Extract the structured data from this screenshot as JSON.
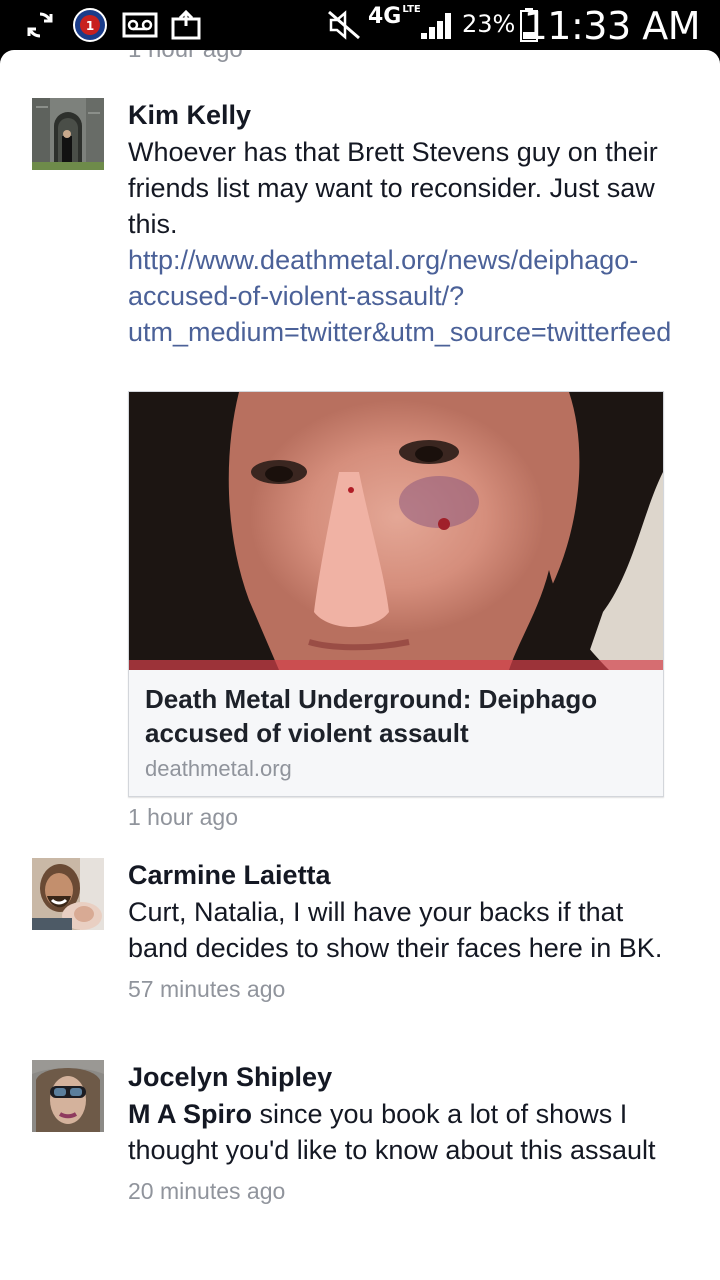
{
  "status_bar": {
    "icons_left": [
      "sync-icon",
      "app-badge-icon",
      "voicemail-icon",
      "upload-icon"
    ],
    "network": "4G",
    "network_sub": "LTE",
    "battery_percent": "23%",
    "time": "11:33 AM"
  },
  "top_partial_timestamp": "1 hour ago",
  "comments": [
    {
      "author": "Kim Kelly",
      "text": "Whoever has that Brett Stevens guy on their friends list may want to reconsider. Just saw this. ",
      "link": "http://www.deathmetal.org/news/deiphago-accused-of-violent-assault/?utm_medium=twitter&utm_source=twitterfeed",
      "link_preview": {
        "title": "Death Metal Underground: Deiphago accused of violent assault",
        "domain": "deathmetal.org"
      },
      "timestamp": "1 hour ago"
    },
    {
      "author": "Carmine Laietta",
      "text": "Curt, Natalia, I will have your backs if that band decides to show their faces here in BK.",
      "timestamp": "57 minutes ago"
    },
    {
      "author": "Jocelyn Shipley",
      "mention": "M A Spiro",
      "text": " since you book a lot of shows I thought you'd like to know about this assault",
      "timestamp": "20 minutes ago"
    }
  ]
}
